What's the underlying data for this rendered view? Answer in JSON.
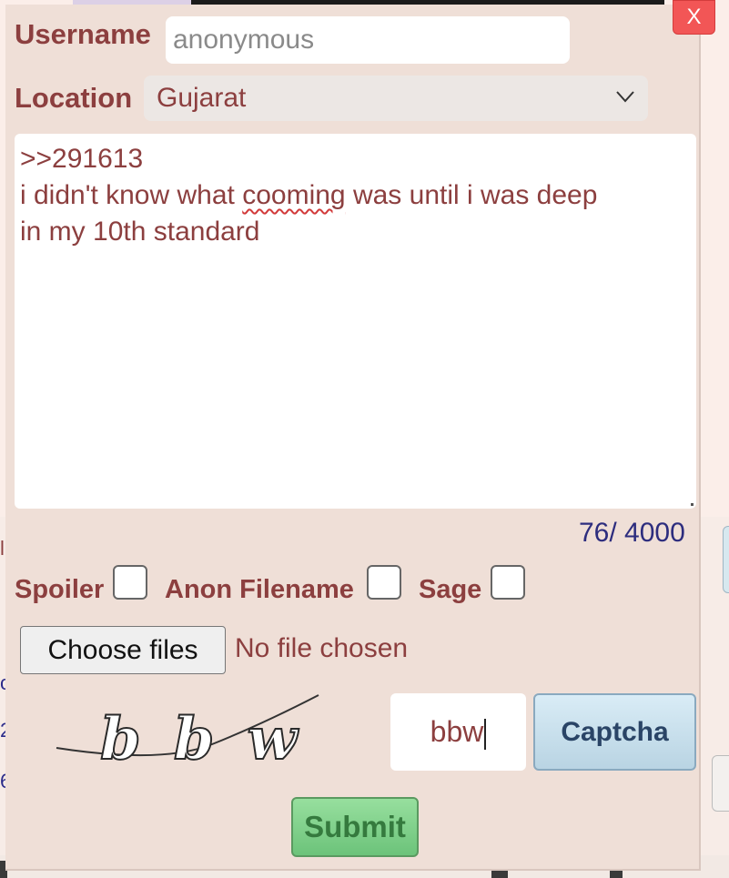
{
  "form": {
    "close_label": "X",
    "username_label": "Username",
    "username_value": "anonymous",
    "location_label": "Location",
    "location_value": "Gujarat",
    "message_lines": [
      ">>291613",
      "i didn't know what ",
      "cooming",
      " was until i was deep",
      "in my 10th standard"
    ],
    "char_count": "76/ 4000",
    "spoiler_label": "Spoiler",
    "anon_filename_label": "Anon Filename",
    "sage_label": "Sage",
    "choose_files_label": "Choose files",
    "file_status": "No file chosen",
    "captcha_image_text": "bbw",
    "captcha_value": "bbw",
    "captcha_button_label": "Captcha",
    "submit_label": "Submit"
  },
  "background_fragments": {
    "edge_chars": [
      "l",
      "c",
      "2",
      "6"
    ]
  },
  "colors": {
    "panel_bg": "#efdfd7",
    "label_text": "#8c3f3f",
    "close_bg": "#f25656",
    "submit_bg": "#7fcf8a",
    "captcha_btn_bg": "#c9e1ee",
    "counter_text": "#2d2d7e"
  },
  "icons": {
    "select_arrow": "chevron-down-icon"
  }
}
